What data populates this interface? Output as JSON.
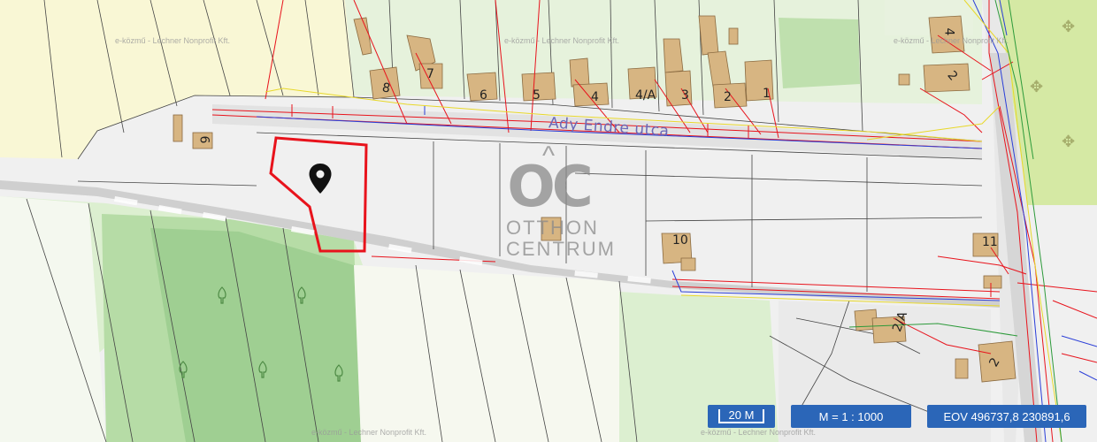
{
  "map": {
    "street_label": "Ady Endre utca",
    "brand": {
      "logo": "OC",
      "line1": "OTTHON",
      "line2": "CENTRUM"
    },
    "watermark": "e-közmű - Lechner Nonprofit Kft.",
    "house_numbers": [
      "6",
      "8",
      "7",
      "6",
      "5",
      "4",
      "4/A",
      "3",
      "2",
      "1",
      "4",
      "2",
      "10",
      "11",
      "2/A",
      "2"
    ]
  },
  "controls": {
    "scale_bar": "20 M",
    "zoom_ratio": "M = 1 : 1000",
    "coordinates": "EOV  496737,8  230891,6"
  },
  "colors": {
    "field_yellow": "#f9f7d5",
    "pasture": "#dcefd0",
    "forest": "#9fcf92",
    "lot": "#f0f0f0",
    "road": "#dedede",
    "building": "#d7b582",
    "boundary_red": "#e8131c"
  },
  "icons": [
    "location-pin-icon",
    "tree-icon",
    "cross-icon"
  ]
}
